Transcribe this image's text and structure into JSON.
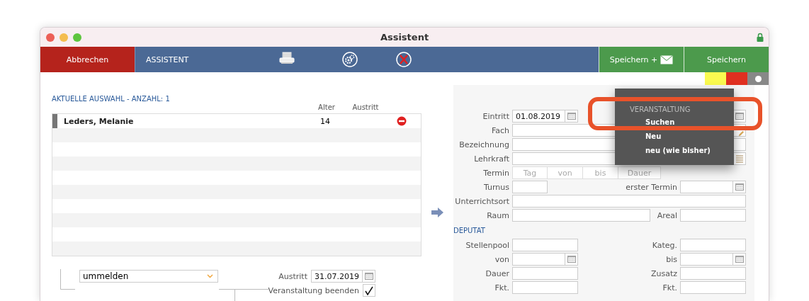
{
  "window": {
    "title": "Assistent"
  },
  "toolbar": {
    "cancel": "Abbrechen",
    "title": "ASSISTENT",
    "save_mail": "Speichern +",
    "save": "Speichern"
  },
  "selection": {
    "heading": "AKTUELLE AUSWAHL - ANZAHL: 1",
    "columns": [
      "Alter",
      "Austritt"
    ],
    "rows": [
      {
        "name": "Leders, Melanie",
        "age": "14"
      }
    ]
  },
  "action": {
    "value": "ummelden"
  },
  "exit": {
    "label": "Austritt",
    "value": "31.07.2019"
  },
  "end_event": {
    "label": "Veranstaltung beenden",
    "checked": true
  },
  "form": {
    "eintritt": {
      "label": "Eintritt",
      "value": "01.08.2019"
    },
    "fach": {
      "label": "Fach"
    },
    "bezeichnung": {
      "label": "Bezeichnung"
    },
    "lehrkraft": {
      "label": "Lehrkraft"
    },
    "termin": {
      "label": "Termin",
      "placeholders": [
        "Tag",
        "von",
        "bis",
        "Dauer"
      ]
    },
    "turnus": {
      "label": "Turnus"
    },
    "erster_termin": {
      "label": "erster Termin"
    },
    "unterrichtsort": {
      "label": "Unterrichtsort"
    },
    "raum": {
      "label": "Raum"
    },
    "areal": {
      "label": "Areal"
    }
  },
  "deputat": {
    "heading": "DEPUTAT",
    "rows": [
      {
        "left": "Stellenpool",
        "right": "Kateg.",
        "kind": "text"
      },
      {
        "left": "von",
        "right": "bis",
        "kind": "date"
      },
      {
        "left": "Dauer",
        "right": "Zusatz",
        "kind": "text"
      },
      {
        "left": "Fkt.",
        "right": "Fkt.",
        "kind": "text"
      }
    ]
  },
  "popup_menu": {
    "heading": "VERANSTALTUNG",
    "items": [
      "Suchen",
      "Neu",
      "neu (wie bisher)"
    ]
  }
}
